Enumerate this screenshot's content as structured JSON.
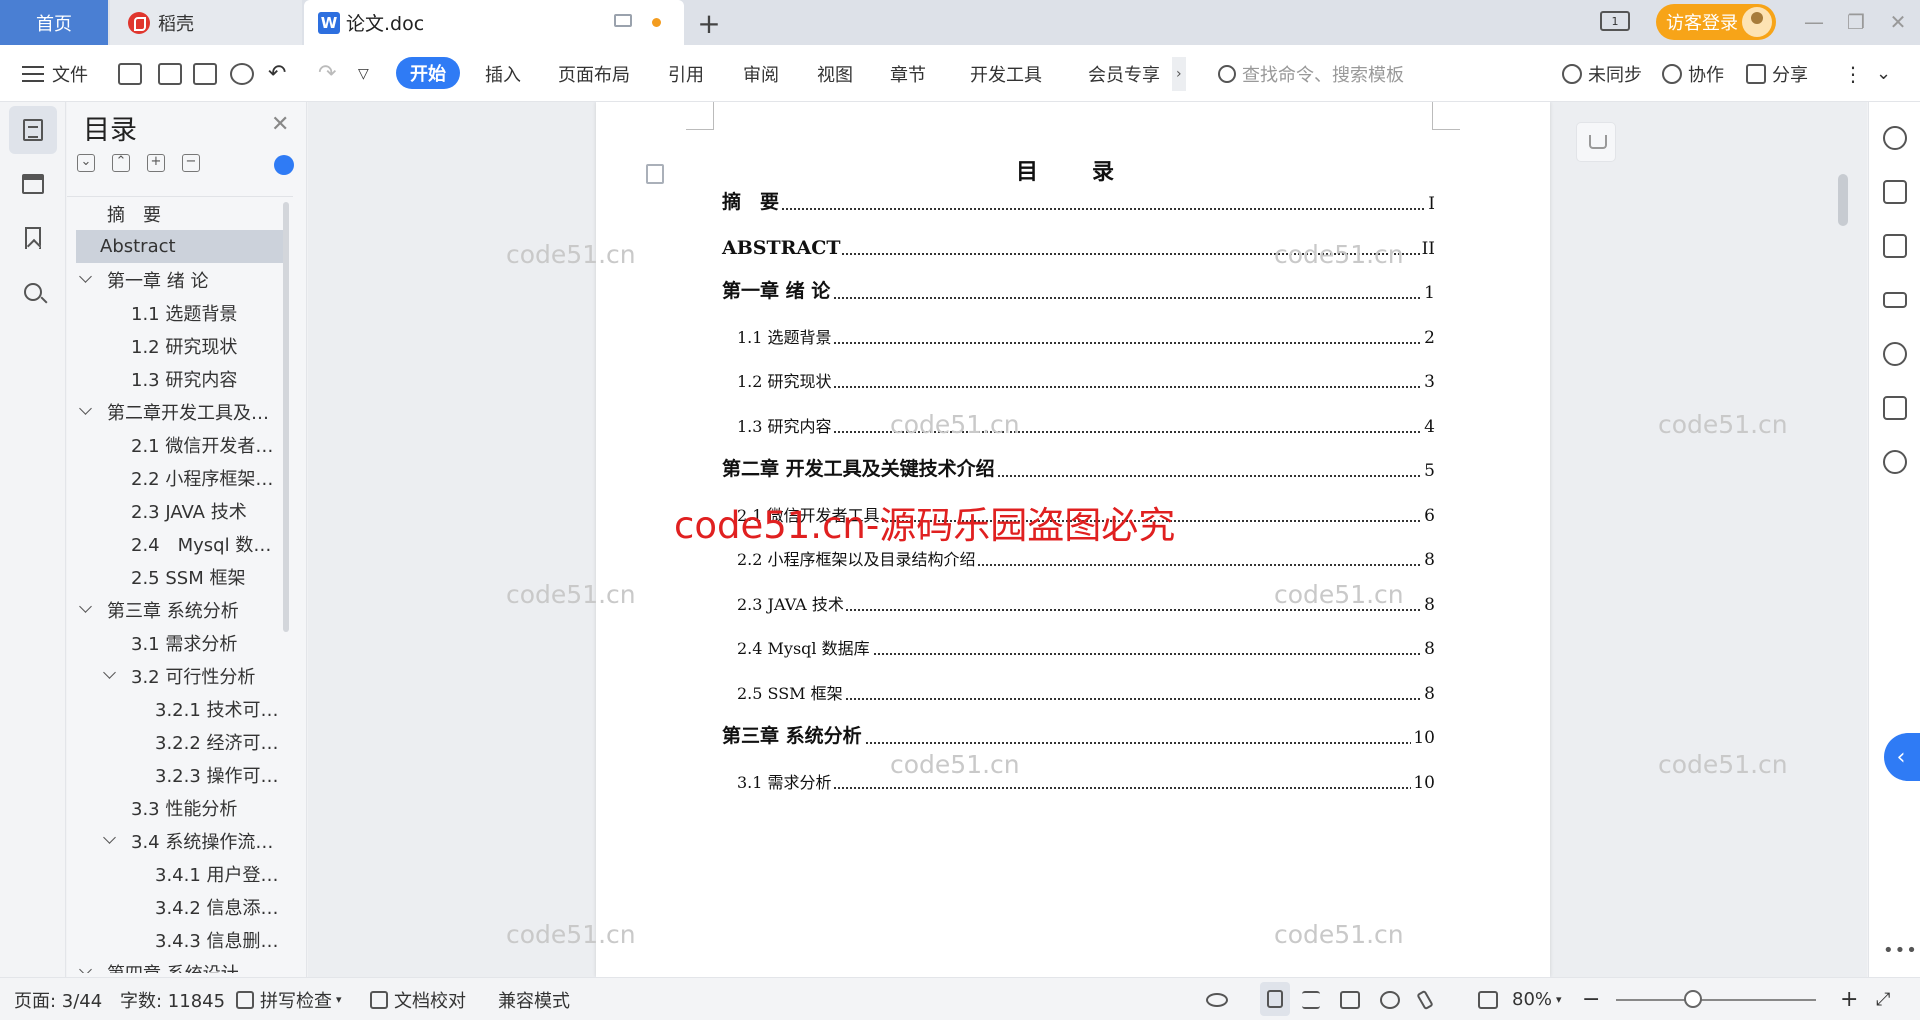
{
  "tabs": {
    "home": "首页",
    "daoke": "稻壳",
    "doc": "论文.doc"
  },
  "header": {
    "visitor_login": "访客登录"
  },
  "ribbon": {
    "file": "文件",
    "menu": [
      "开始",
      "插入",
      "页面布局",
      "引用",
      "审阅",
      "视图",
      "章节",
      "开发工具",
      "会员专享"
    ],
    "search_placeholder": "查找命令、搜索模板",
    "sync": "未同步",
    "collab": "协作",
    "share": "分享"
  },
  "toc_pane": {
    "title": "目录",
    "items": [
      {
        "label": "摘　要",
        "level": 1,
        "chevron": false,
        "active": false
      },
      {
        "label": "Abstract",
        "level": 1,
        "chevron": false,
        "active": true
      },
      {
        "label": "第一章 绪 论",
        "level": 1,
        "chevron": true
      },
      {
        "label": "1.1 选题背景",
        "level": 2
      },
      {
        "label": "1.2 研究现状",
        "level": 2
      },
      {
        "label": "1.3 研究内容",
        "level": 2
      },
      {
        "label": "第二章开发工具及…",
        "level": 1,
        "chevron": true
      },
      {
        "label": "2.1 微信开发者…",
        "level": 2
      },
      {
        "label": "2.2 小程序框架…",
        "level": 2
      },
      {
        "label": "2.3 JAVA 技术",
        "level": 2
      },
      {
        "label": "2.4　Mysql 数…",
        "level": 2
      },
      {
        "label": "2.5 SSM 框架",
        "level": 2
      },
      {
        "label": "第三章 系统分析",
        "level": 1,
        "chevron": true
      },
      {
        "label": "3.1 需求分析",
        "level": 2
      },
      {
        "label": "3.2 可行性分析",
        "level": 2,
        "chevron": true
      },
      {
        "label": "3.2.1 技术可…",
        "level": 3
      },
      {
        "label": "3.2.2 经济可…",
        "level": 3
      },
      {
        "label": "3.2.3 操作可…",
        "level": 3
      },
      {
        "label": "3.3 性能分析",
        "level": 2
      },
      {
        "label": "3.4 系统操作流…",
        "level": 2,
        "chevron": true
      },
      {
        "label": "3.4.1 用户登…",
        "level": 3
      },
      {
        "label": "3.4.2 信息添…",
        "level": 3
      },
      {
        "label": "3.4.3 信息删…",
        "level": 3
      },
      {
        "label": "第四章 系统设计",
        "level": 1,
        "chevron": true
      }
    ]
  },
  "document": {
    "title": "目　录",
    "entries": [
      {
        "text": "摘　要",
        "page": "I",
        "style": "h1"
      },
      {
        "text": "ABSTRACT",
        "page": "II",
        "style": "h1"
      },
      {
        "text": "第一章 绪 论",
        "page": "1",
        "style": "h1"
      },
      {
        "text": "1.1 选题背景",
        "page": "2",
        "style": "h2"
      },
      {
        "text": "1.2 研究现状",
        "page": "3",
        "style": "h2"
      },
      {
        "text": "1.3 研究内容",
        "page": "4",
        "style": "h2"
      },
      {
        "text": "第二章 开发工具及关键技术介绍",
        "page": "5",
        "style": "h1"
      },
      {
        "text": "2.1 微信开发者工具",
        "page": "6",
        "style": "h2"
      },
      {
        "text": "2.2 小程序框架以及目录结构介绍",
        "page": "8",
        "style": "h2"
      },
      {
        "text": "2.3 JAVA 技术",
        "page": "8",
        "style": "h2"
      },
      {
        "text": "2.4 Mysql 数据库",
        "page": "8",
        "style": "h2"
      },
      {
        "text": "2.5 SSM 框架",
        "page": "8",
        "style": "h2"
      },
      {
        "text": "第三章 系统分析",
        "page": "10",
        "style": "h1"
      },
      {
        "text": "3.1 需求分析",
        "page": "10",
        "style": "h2"
      }
    ],
    "watermark": "code51.cn",
    "red_watermark": "code51.cn-源码乐园盗图必究"
  },
  "status": {
    "page": "页面: 3/44",
    "words": "字数: 11845",
    "spell": "拼写检查",
    "proof": "文档校对",
    "compat": "兼容模式",
    "zoom": "80%"
  }
}
